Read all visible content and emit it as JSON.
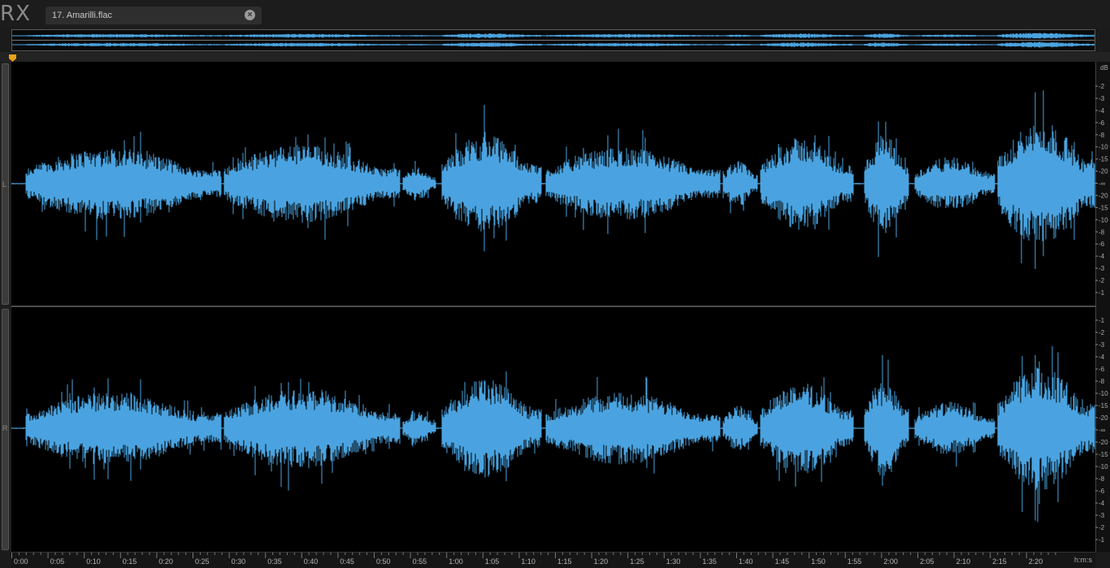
{
  "app": {
    "logo": "RX"
  },
  "tab": {
    "label": "17. Amarilli.flac",
    "close_glyph": "×"
  },
  "channels": {
    "left_label": "L",
    "right_label": "R"
  },
  "db_scale": {
    "unit": "dB",
    "ticks_left": [
      "-2",
      "-3",
      "-4",
      "-6",
      "-8",
      "-10",
      "-15",
      "-20",
      "-∞",
      "-20",
      "-15",
      "-10",
      "-8",
      "-6",
      "-4",
      "-3",
      "-2",
      "-1"
    ],
    "ticks_right": [
      "-1",
      "-2",
      "-3",
      "-4",
      "-6",
      "-8",
      "-10",
      "-15",
      "-20",
      "-∞",
      "-20",
      "-15",
      "-10",
      "-8",
      "-6",
      "-4",
      "-3",
      "-2",
      "-1"
    ]
  },
  "time_ruler": {
    "unit": "h:m:s",
    "labels": [
      "0:00",
      "0:05",
      "0:10",
      "0:15",
      "0:20",
      "0:25",
      "0:30",
      "0:35",
      "0:40",
      "0:45",
      "0:50",
      "0:55",
      "1:00",
      "1:05",
      "1:10",
      "1:15",
      "1:20",
      "1:25",
      "1:30",
      "1:35",
      "1:40",
      "1:45",
      "1:50",
      "1:55",
      "2:00",
      "2:05",
      "2:10",
      "2:15",
      "2:20"
    ]
  },
  "colors": {
    "waveform": "#4aa3e0",
    "overview_wave": "#4aa3e0",
    "playhead": "#e8a21c",
    "background": "#000000"
  },
  "icons": {
    "playhead": "playhead-marker-icon",
    "close": "close-icon"
  }
}
